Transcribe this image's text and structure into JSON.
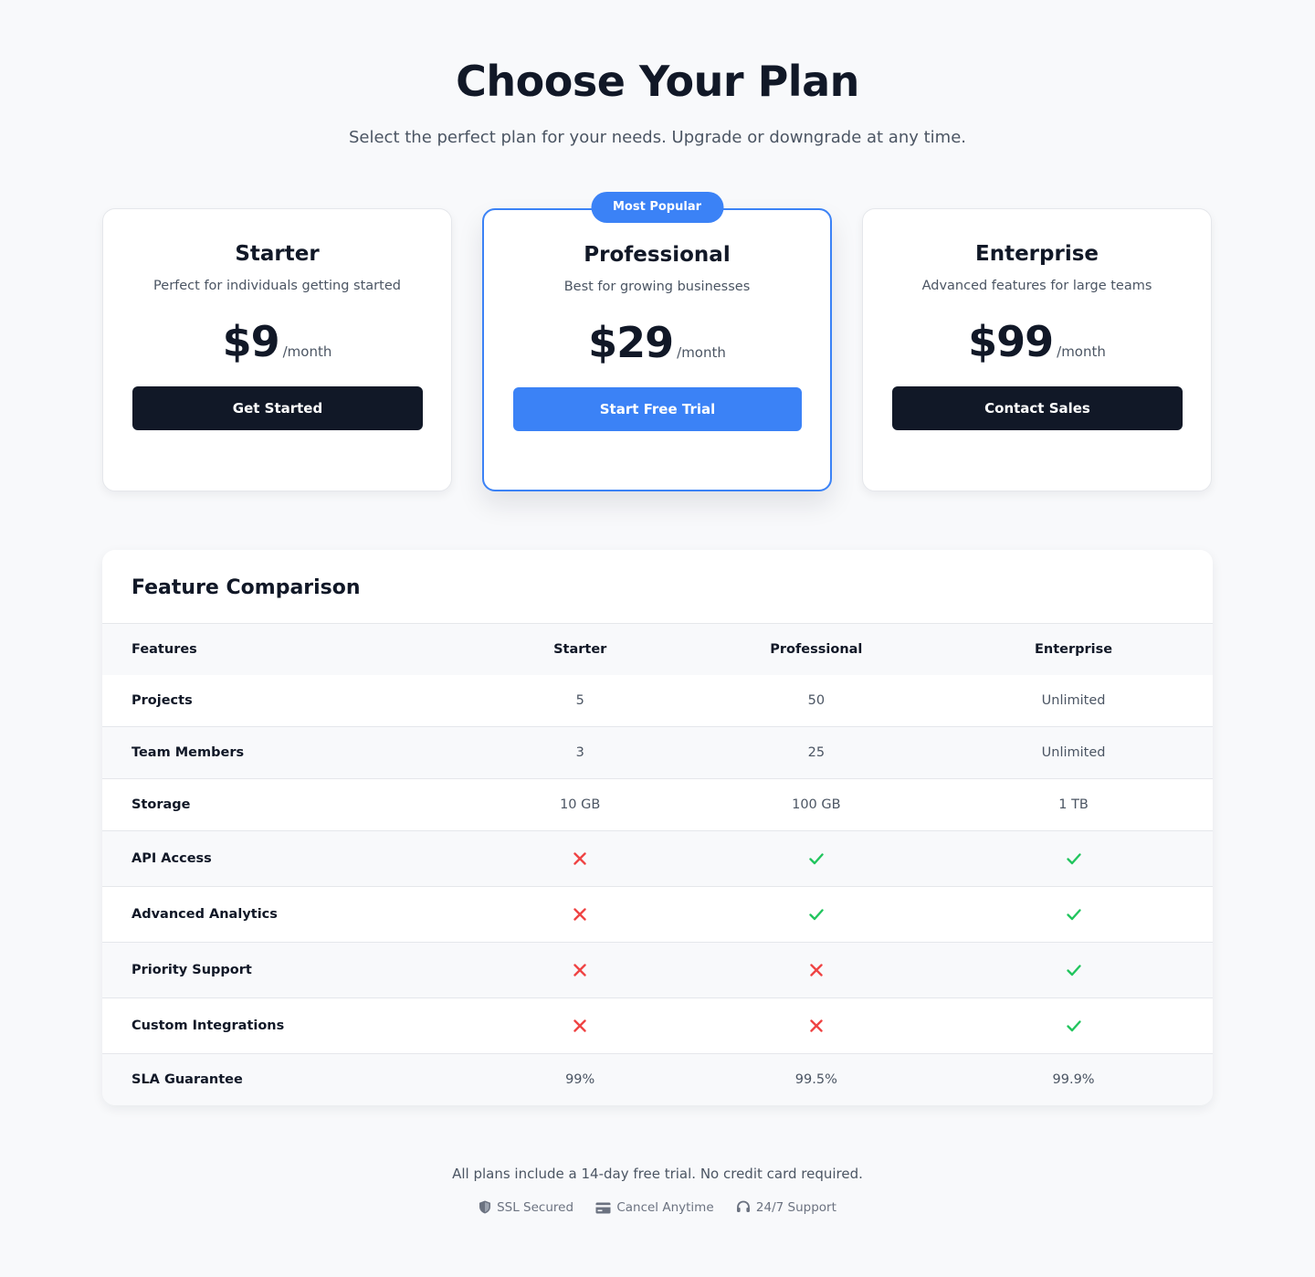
{
  "header": {
    "title": "Choose Your Plan",
    "subtitle": "Select the perfect plan for your needs. Upgrade or downgrade at any time."
  },
  "plans": [
    {
      "name": "Starter",
      "description": "Perfect for individuals getting started",
      "price": "$9",
      "period": "/month",
      "button": "Get Started"
    },
    {
      "name": "Professional",
      "badge": "Most Popular",
      "description": "Best for growing businesses",
      "price": "$29",
      "period": "/month",
      "button": "Start Free Trial"
    },
    {
      "name": "Enterprise",
      "description": "Advanced features for large teams",
      "price": "$99",
      "period": "/month",
      "button": "Contact Sales"
    }
  ],
  "comparison": {
    "title": "Feature Comparison",
    "columns": [
      "Features",
      "Starter",
      "Professional",
      "Enterprise"
    ],
    "rows": [
      {
        "feature": "Projects",
        "values": [
          "5",
          "50",
          "Unlimited"
        ]
      },
      {
        "feature": "Team Members",
        "values": [
          "3",
          "25",
          "Unlimited"
        ]
      },
      {
        "feature": "Storage",
        "values": [
          "10 GB",
          "100 GB",
          "1 TB"
        ]
      },
      {
        "feature": "API Access",
        "values": [
          false,
          true,
          true
        ]
      },
      {
        "feature": "Advanced Analytics",
        "values": [
          false,
          true,
          true
        ]
      },
      {
        "feature": "Priority Support",
        "values": [
          false,
          false,
          true
        ]
      },
      {
        "feature": "Custom Integrations",
        "values": [
          false,
          false,
          true
        ]
      },
      {
        "feature": "SLA Guarantee",
        "values": [
          "99%",
          "99.5%",
          "99.9%"
        ]
      }
    ]
  },
  "footer": {
    "note": "All plans include a 14-day free trial. No credit card required.",
    "badges": [
      {
        "icon": "shield-icon",
        "label": "SSL Secured"
      },
      {
        "icon": "credit-card-icon",
        "label": "Cancel Anytime"
      },
      {
        "icon": "headset-icon",
        "label": "24/7 Support"
      }
    ]
  },
  "colors": {
    "accent": "#3b82f6",
    "dark_button": "#111827",
    "check": "#22c55e",
    "cross": "#ef4444",
    "background": "#f8f9fb"
  }
}
